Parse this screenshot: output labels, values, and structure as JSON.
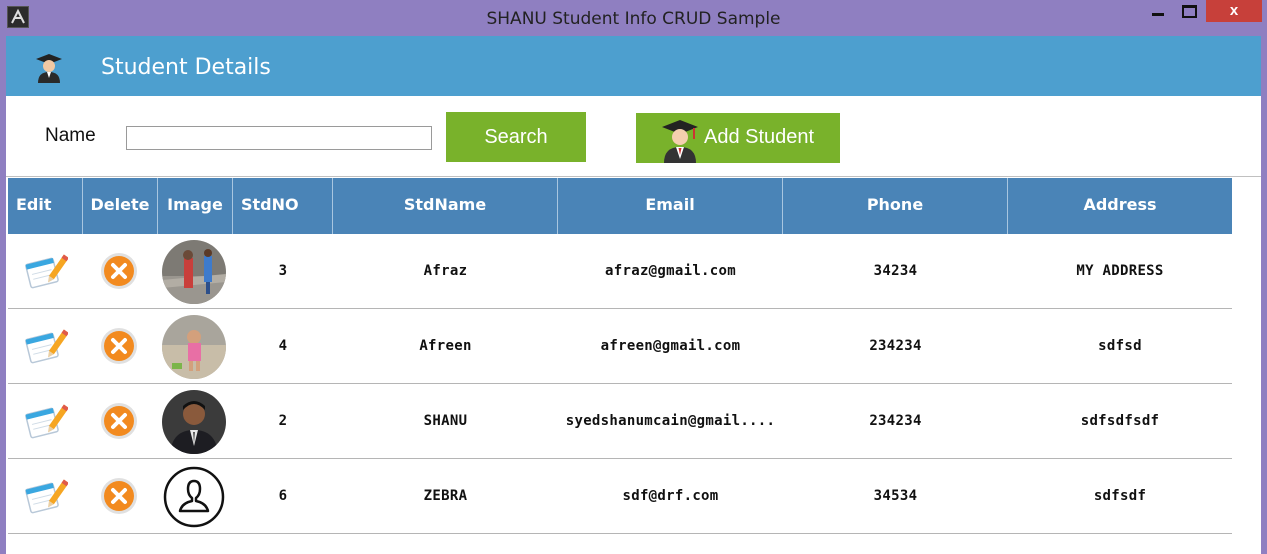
{
  "window": {
    "title": "SHANU Student Info CRUD Sample",
    "close_label": "x"
  },
  "header": {
    "title": "Student Details",
    "icon": "graduate-icon"
  },
  "search": {
    "label": "Name",
    "value": "",
    "placeholder": "",
    "button_label": "Search"
  },
  "add_button": {
    "label": "Add Student",
    "icon": "graduate-icon"
  },
  "table": {
    "columns": [
      "Edit",
      "Delete",
      "Image",
      "StdNO",
      "StdName",
      "Email",
      "Phone",
      "Address"
    ],
    "rows": [
      {
        "std_no": "3",
        "name": "Afraz",
        "email": "afraz@gmail.com",
        "phone": "34234",
        "address": "MY ADDRESS",
        "image": "child-photo"
      },
      {
        "std_no": "4",
        "name": "Afreen",
        "email": "afreen@gmail.com",
        "phone": "234234",
        "address": "sdfsd",
        "image": "child-beach-photo"
      },
      {
        "std_no": "2",
        "name": "SHANU",
        "email": "syedshanumcain@gmail....",
        "phone": "234234",
        "address": "sdfsdfsdf",
        "image": "man-photo"
      },
      {
        "std_no": "6",
        "name": "ZEBRA",
        "email": "sdf@drf.com",
        "phone": "34534",
        "address": "sdfsdf",
        "image": "default-user-icon"
      }
    ]
  },
  "colors": {
    "titlebar": "#8f7fc1",
    "header": "#4d9fcf",
    "grid_header": "#4a84b7",
    "button_green": "#79b22b",
    "close_red": "#c7403a"
  }
}
